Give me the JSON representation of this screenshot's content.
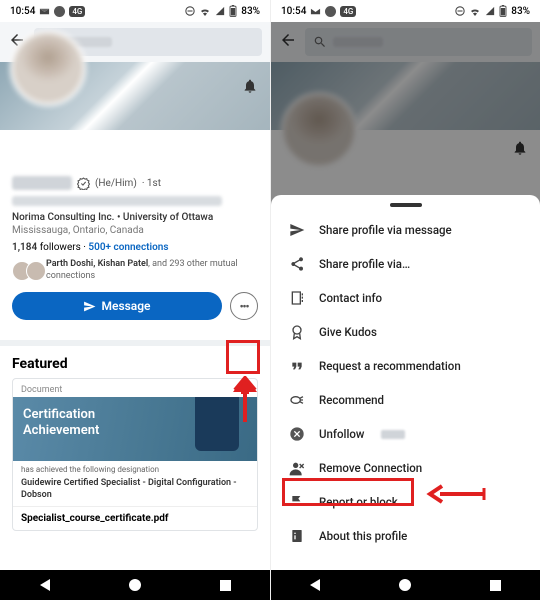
{
  "status": {
    "time": "10:54",
    "battery": "83%"
  },
  "profile": {
    "pronouns": "(He/Him)",
    "degree": "1st",
    "company_line": "Norima Consulting Inc. • University of Ottawa",
    "location": "Mississauga, Ontario, Canada",
    "followers_count": "1,184",
    "followers_label": "followers",
    "connections": "500+ connections",
    "mutual_names": "Parth Doshi, Kishan Patel",
    "mutual_rest": ", and 293 other mutual connections",
    "message_btn": "Message"
  },
  "featured": {
    "heading": "Featured",
    "doc_label": "Document",
    "cert_line1": "Certification",
    "cert_line2": "Achievement",
    "designation_prefix": "has achieved the following designation",
    "description": "Guidewire Certified Specialist - Digital Configuration - Dobson",
    "filename": "Specialist_course_certificate.pdf"
  },
  "menu": {
    "items": [
      "Share profile via message",
      "Share profile via…",
      "Contact info",
      "Give Kudos",
      "Request a recommendation",
      "Recommend",
      "Unfollow",
      "Remove Connection",
      "Report or block",
      "About this profile"
    ]
  }
}
